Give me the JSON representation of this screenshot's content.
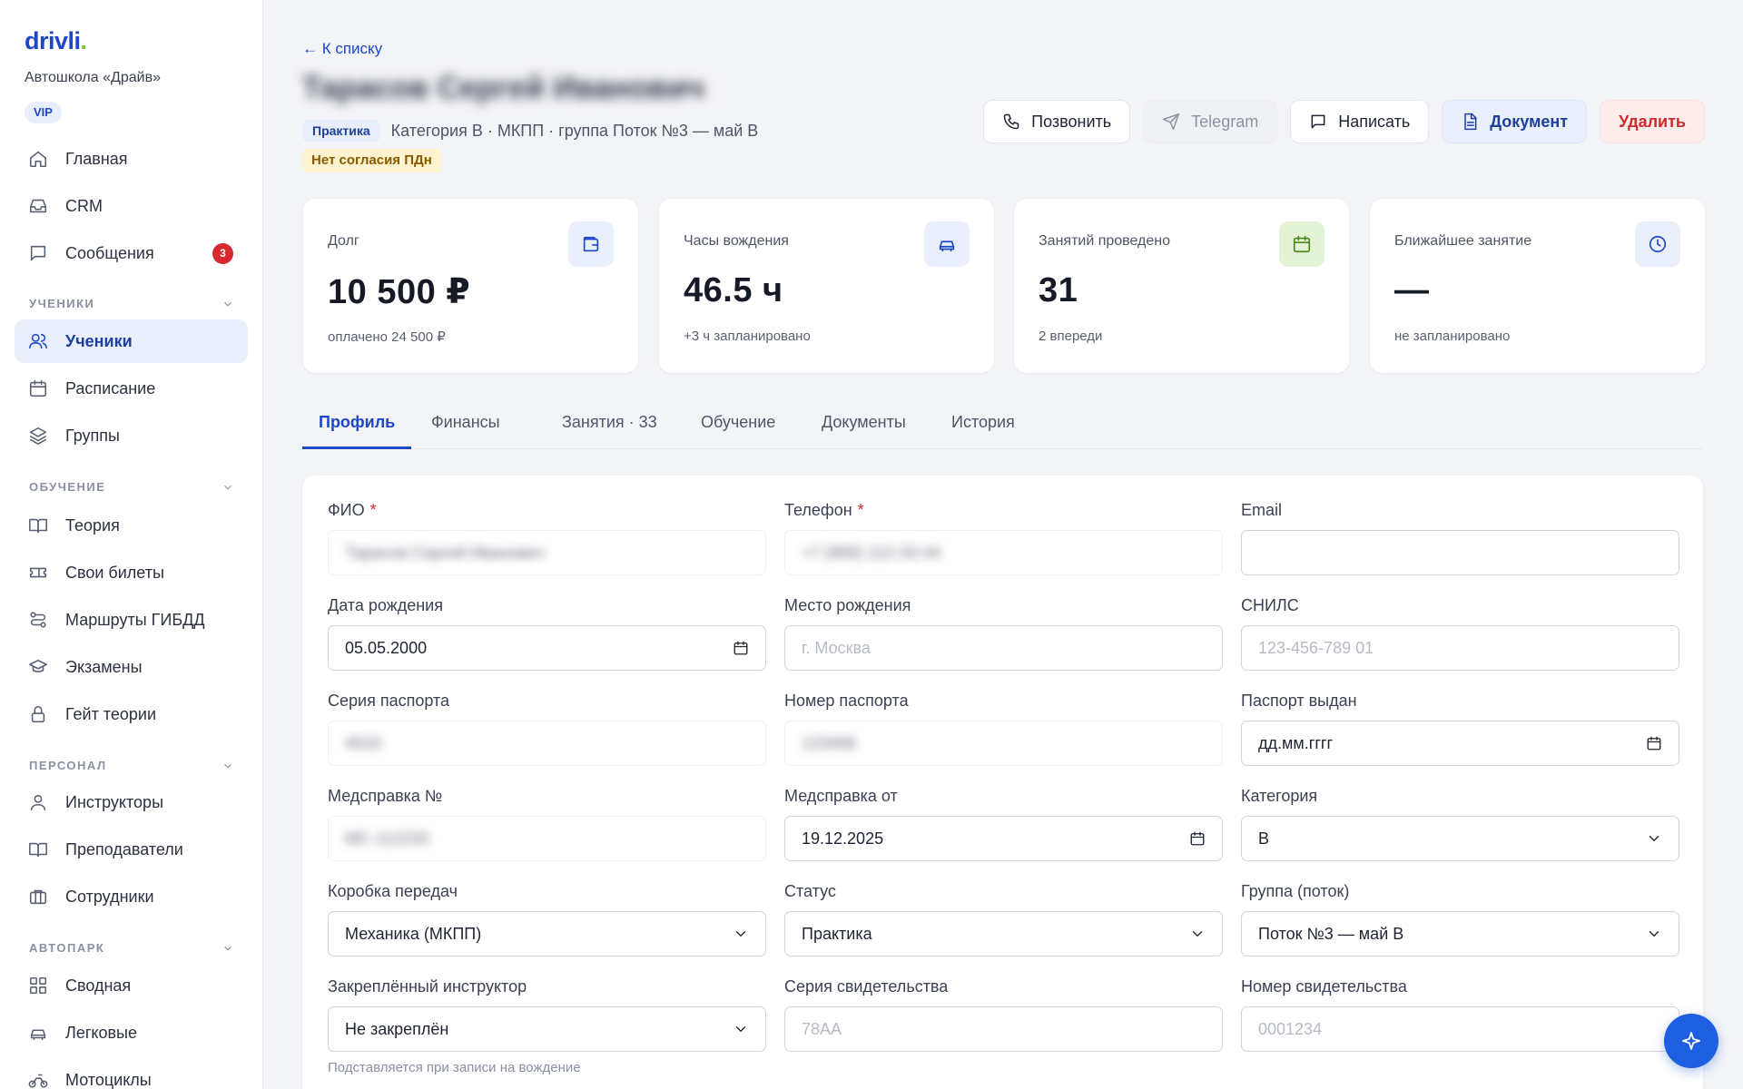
{
  "sidebar": {
    "logo_main": "drivli",
    "logo_dot": ".",
    "school": "Автошкола «Драйв»",
    "plan": "VIP",
    "items": [
      {
        "label": "Главная",
        "icon": "home-icon"
      },
      {
        "label": "CRM",
        "icon": "inbox-icon"
      },
      {
        "label": "Сообщения",
        "icon": "message-icon",
        "badge": "3"
      },
      {
        "label": "Ученики",
        "icon": "users-icon",
        "active": true
      },
      {
        "label": "Расписание",
        "icon": "calendar-icon"
      },
      {
        "label": "Группы",
        "icon": "layers-icon"
      },
      {
        "label": "Теория",
        "icon": "book-icon"
      },
      {
        "label": "Свои билеты",
        "icon": "ticket-icon"
      },
      {
        "label": "Маршруты ГИБДД",
        "icon": "route-icon"
      },
      {
        "label": "Экзамены",
        "icon": "graduation-icon"
      },
      {
        "label": "Гейт теории",
        "icon": "lock-icon"
      },
      {
        "label": "Инструкторы",
        "icon": "user-icon"
      },
      {
        "label": "Преподаватели",
        "icon": "book-open-icon"
      },
      {
        "label": "Сотрудники",
        "icon": "briefcase-icon"
      },
      {
        "label": "Сводная",
        "icon": "grid-icon"
      },
      {
        "label": "Легковые",
        "icon": "car-icon"
      },
      {
        "label": "Мотоциклы",
        "icon": "motorcycle-icon"
      }
    ],
    "sections": {
      "students": "УЧЕНИКИ",
      "learning": "ОБУЧЕНИЕ",
      "staff": "ПЕРСОНАЛ",
      "fleet": "АВТОПАРК"
    }
  },
  "header": {
    "back": "← К списку",
    "student_name": "Тарасов Сергей Иванович",
    "status_tag": "Практика",
    "meta": "Категория B · МКПП · группа Поток №3 — май B",
    "warning_tag": "Нет согласия ПДн",
    "actions": {
      "call": "Позвонить",
      "telegram": "Telegram",
      "write": "Написать",
      "document": "Документ",
      "delete": "Удалить"
    }
  },
  "stats": [
    {
      "label": "Долг",
      "value": "10 500 ₽",
      "sub": "оплачено 24 500 ₽",
      "icon": "wallet-icon"
    },
    {
      "label": "Часы вождения",
      "value": "46.5 ч",
      "sub": "+3 ч запланировано",
      "icon": "car-icon"
    },
    {
      "label": "Занятий проведено",
      "value": "31",
      "sub": "2 впереди",
      "icon": "calendar-icon"
    },
    {
      "label": "Ближайшее занятие",
      "value": "—",
      "sub": "не запланировано",
      "icon": "clock-icon"
    }
  ],
  "tabs": [
    "Профиль",
    "Финансы",
    "Занятия · 33",
    "Обучение",
    "Документы",
    "История"
  ],
  "form": {
    "fio": {
      "label": "ФИО",
      "value": "Тарасов Сергей Иванович"
    },
    "phone": {
      "label": "Телефон",
      "value": "+7 (900) 112-33-44"
    },
    "email": {
      "label": "Email",
      "value": ""
    },
    "birth_date": {
      "label": "Дата рождения",
      "value": "05.05.2000"
    },
    "birth_place": {
      "label": "Место рождения",
      "placeholder": "г. Москва"
    },
    "snils": {
      "label": "СНИЛС",
      "placeholder": "123-456-789 01"
    },
    "passport_series": {
      "label": "Серия паспорта",
      "value": "4510"
    },
    "passport_number": {
      "label": "Номер паспорта",
      "value": "123456"
    },
    "passport_issued": {
      "label": "Паспорт выдан",
      "value": "дд.мм.гггг"
    },
    "med_number": {
      "label": "Медсправка №",
      "value": "МС-112233"
    },
    "med_date": {
      "label": "Медсправка от",
      "value": "19.12.2025"
    },
    "category": {
      "label": "Категория",
      "value": "B"
    },
    "gearbox": {
      "label": "Коробка передач",
      "value": "Механика (МКПП)"
    },
    "status": {
      "label": "Статус",
      "value": "Практика"
    },
    "group": {
      "label": "Группа (поток)",
      "value": "Поток №3 — май B"
    },
    "instructor": {
      "label": "Закреплённый инструктор",
      "value": "Не закреплён",
      "hint": "Подставляется при записи на вождение"
    },
    "cert_series": {
      "label": "Серия свидетельства",
      "placeholder": "78AA"
    },
    "cert_number": {
      "label": "Номер свидетельства",
      "placeholder": "0001234"
    },
    "required_mark": "*"
  }
}
